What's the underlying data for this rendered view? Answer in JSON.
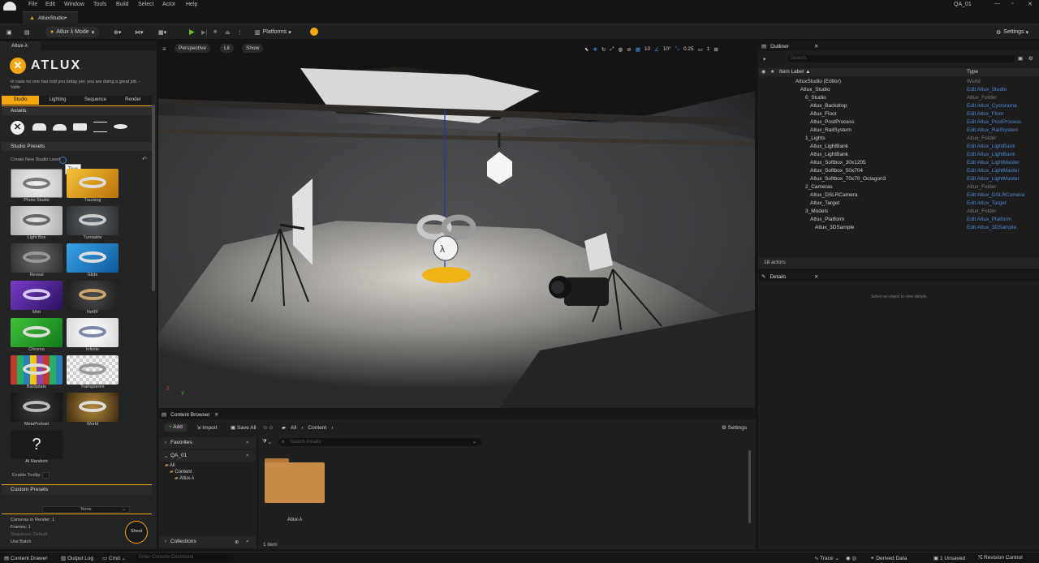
{
  "menu": {
    "items": [
      "File",
      "Edit",
      "Window",
      "Tools",
      "Build",
      "Select",
      "Actor",
      "Help"
    ],
    "project": "QA_01"
  },
  "doc_tab": "AtluxStudio•",
  "toolbar": {
    "mode": "Atlux λ Mode",
    "platforms": "Platforms",
    "settings": "Settings"
  },
  "left_panel": {
    "tab_title": "Atlux-λ",
    "logo_text": "ATLUX",
    "quote": "In case no one has told you today yet, you are doing a great job. -Valle",
    "tabs": [
      "Studio",
      "Lighting",
      "Sequence",
      "Render"
    ],
    "assets_header": "Assets",
    "presets_header": "Studio Presets",
    "create_level": "Create New Studio Level",
    "tooltip": "True",
    "presets": [
      "Photo Studio",
      "Tracking",
      "Light Box",
      "Turntable",
      "Reveal",
      "Glide",
      "Mist",
      "NeRF",
      "Chroma",
      "Infinite",
      "Backplate",
      "Transparent",
      "MetaPortrait",
      "World",
      "AI Random"
    ],
    "enable_tooltip": "Enable Tooltip",
    "custom_presets": "Custom Presets",
    "dropdown_value": "None",
    "cameras_to_render": "Cameras to Render: 1",
    "frames": "Frames: 1",
    "sequence": "Sequence: Default",
    "use_batch": "Use Batch",
    "shoot": "Shoot",
    "colors": {
      "accent": "#f3a712"
    }
  },
  "viewport": {
    "perspective": "Perspective",
    "lit": "Lit",
    "show": "Show",
    "grid": "10",
    "angle": "10°",
    "scale": "0.25",
    "cam_speed": "1",
    "axis_z": "Z",
    "axis_y": "Y"
  },
  "outliner": {
    "title": "Outliner",
    "search_placeholder": "Search",
    "col_label": "Item Label ▲",
    "col_type": "Type",
    "rows": [
      {
        "name": "AtluxStudio (Editor)",
        "type": "World",
        "link": false
      },
      {
        "name": "Atlux_Studio",
        "type": "Edit Atlux_Studio",
        "link": true
      },
      {
        "name": "0_Studio",
        "type": "Atlux_Folder",
        "link": false
      },
      {
        "name": "Atlux_Backdrop",
        "type": "Edit Atlux_Cyclorama",
        "link": true
      },
      {
        "name": "Atlux_Floor",
        "type": "Edit Atlux_Floor",
        "link": true
      },
      {
        "name": "Atlux_PostProcess",
        "type": "Edit Atlux_PostProcess",
        "link": true
      },
      {
        "name": "Atlux_RailSystem",
        "type": "Edit Atlux_RailSystem",
        "link": true
      },
      {
        "name": "1_Lights",
        "type": "Atlux_Folder",
        "link": false
      },
      {
        "name": "Atlux_LightBank",
        "type": "Edit Atlux_LightBank",
        "link": true
      },
      {
        "name": "Atlux_LightBank",
        "type": "Edit Atlux_LightBank",
        "link": true
      },
      {
        "name": "Atlux_Softbox_30x1205",
        "type": "Edit Atlux_LightMaster",
        "link": true
      },
      {
        "name": "Atlux_Softbox_50x704",
        "type": "Edit Atlux_LightMaster",
        "link": true
      },
      {
        "name": "Atlux_Softbox_70x70_Octagon3",
        "type": "Edit Atlux_LightMaster",
        "link": true
      },
      {
        "name": "2_Cameras",
        "type": "Atlux_Folder",
        "link": false
      },
      {
        "name": "Atlux_DSLRCamera",
        "type": "Edit Atlux_DSLRCamera",
        "link": true
      },
      {
        "name": "Atlux_Target",
        "type": "Edit Atlux_Target",
        "link": true
      },
      {
        "name": "3_Models",
        "type": "Atlux_Folder",
        "link": false
      },
      {
        "name": "Atlux_Platform",
        "type": "Edit Atlux_Platform",
        "link": true
      },
      {
        "name": "Atlux_3DSample",
        "type": "Edit Atlux_3DSample",
        "link": true
      }
    ],
    "actor_count": "18 actors"
  },
  "details": {
    "title": "Details",
    "empty": "Select an object to view details"
  },
  "content_browser": {
    "title": "Content Browser",
    "add": "Add",
    "import": "Import",
    "save_all": "Save All",
    "path": [
      "All",
      "Content"
    ],
    "settings": "Settings",
    "favorites": "Favorites",
    "project": "QA_01",
    "tree": [
      "All",
      "Content",
      "Atlux-λ"
    ],
    "filter_placeholder": "Search Assets",
    "folder": "Atlux-λ",
    "collections": "Collections",
    "item_count": "1 item"
  },
  "status": {
    "content_drawer": "Content Drawer",
    "output_log": "Output Log",
    "cmd": "Cmd",
    "console_placeholder": "Enter Console Command",
    "trace": "Trace",
    "derived": "Derived Data",
    "unsaved": "1 Unsaved",
    "revision": "Revision Control"
  }
}
